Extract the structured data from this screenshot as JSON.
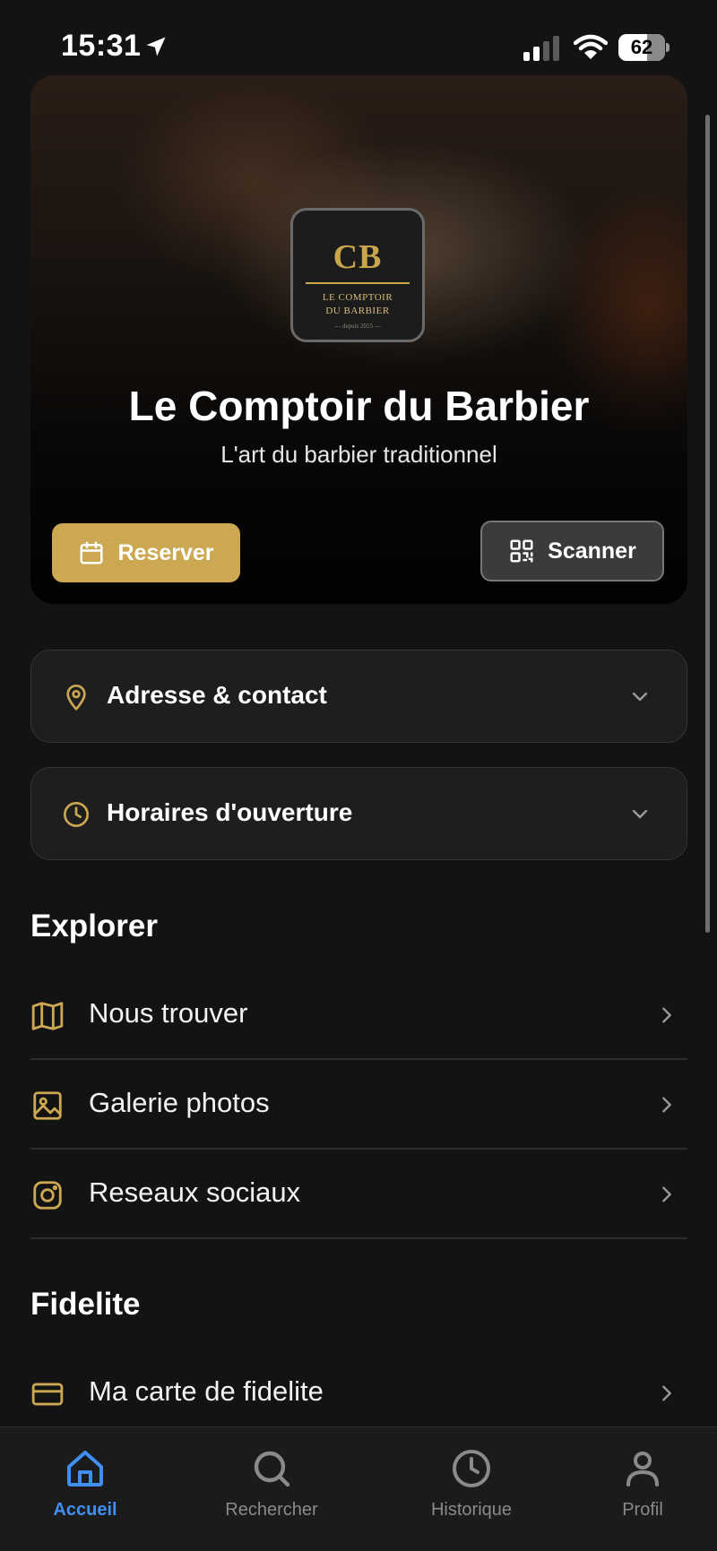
{
  "status_bar": {
    "time": "15:31",
    "battery": "62",
    "battery_level": 0.62
  },
  "hero": {
    "logo": {
      "monogram": "CB",
      "line1": "LE COMPTOIR",
      "line2": "DU BARBIER",
      "since": "— depuis 2015 —"
    },
    "title": "Le Comptoir du Barbier",
    "subtitle": "L'art du barbier traditionnel",
    "reserve_label": "Reserver",
    "scan_label": "Scanner"
  },
  "accordions": [
    {
      "label": "Adresse & contact",
      "icon": "map-pin-icon"
    },
    {
      "label": "Horaires d'ouverture",
      "icon": "clock-icon"
    }
  ],
  "explorer": {
    "title": "Explorer",
    "items": [
      {
        "label": "Nous trouver",
        "icon": "map-icon"
      },
      {
        "label": "Galerie photos",
        "icon": "image-icon"
      },
      {
        "label": "Reseaux sociaux",
        "icon": "instagram-icon"
      }
    ]
  },
  "fidelite": {
    "title": "Fidelite",
    "items": [
      {
        "label": "Ma carte de fidelite",
        "icon": "credit-card-icon"
      }
    ]
  },
  "tabbar": {
    "tabs": [
      {
        "label": "Accueil",
        "icon": "home-icon",
        "active": true
      },
      {
        "label": "Rechercher",
        "icon": "search-icon",
        "active": false
      },
      {
        "label": "Historique",
        "icon": "history-icon",
        "active": false
      },
      {
        "label": "Profil",
        "icon": "profile-icon",
        "active": false
      }
    ]
  },
  "colors": {
    "accent_gold": "#cba851",
    "active_blue": "#3f8ef2",
    "background": "#131313"
  }
}
